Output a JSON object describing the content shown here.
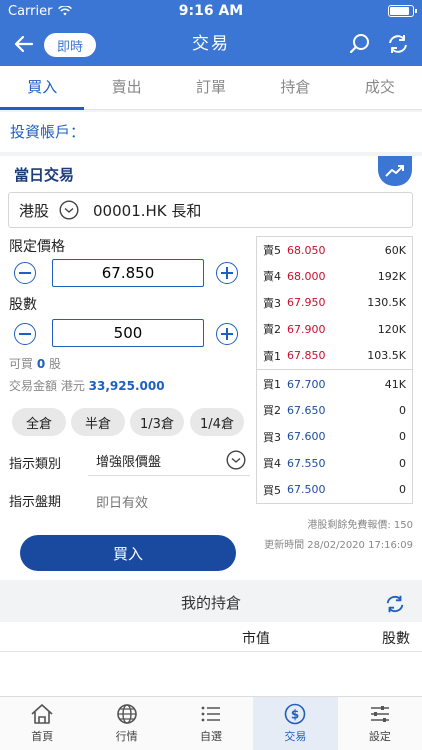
{
  "status": {
    "carrier": "Carrier",
    "time": "9:16 AM"
  },
  "header": {
    "mode_pill": "即時",
    "title": "交易"
  },
  "tabs": [
    {
      "label": "買入",
      "active": true
    },
    {
      "label": "賣出",
      "active": false
    },
    {
      "label": "訂單",
      "active": false
    },
    {
      "label": "持倉",
      "active": false
    },
    {
      "label": "成交",
      "active": false
    }
  ],
  "account": {
    "label": "投資帳戶："
  },
  "trade": {
    "section_title": "當日交易",
    "market": "港股",
    "stock": "00001.HK 長和",
    "limit_price_label": "限定價格",
    "limit_price": "67.850",
    "quantity_label": "股數",
    "quantity": "500",
    "buyable_label": "可買",
    "buyable_value": "0",
    "buyable_unit": "股",
    "amount_label": "交易金額 港元",
    "amount_value": "33,925.000",
    "position_buttons": [
      "全倉",
      "半倉",
      "1/3倉",
      "1/4倉"
    ],
    "order_type_label": "指示類別",
    "order_type_value": "增強限價盤",
    "validity_label": "指示盤期",
    "validity_value": "即日有效",
    "buy_button": "買入",
    "quote_quota": "港股剩餘免費報價: 150",
    "update_time": "更新時間 28/02/2020 17:16:09"
  },
  "order_book": {
    "asks": [
      {
        "side": "賣5",
        "price": "68.050",
        "qty": "60K"
      },
      {
        "side": "賣4",
        "price": "68.000",
        "qty": "192K"
      },
      {
        "side": "賣3",
        "price": "67.950",
        "qty": "130.5K"
      },
      {
        "side": "賣2",
        "price": "67.900",
        "qty": "120K"
      },
      {
        "side": "賣1",
        "price": "67.850",
        "qty": "103.5K"
      }
    ],
    "bids": [
      {
        "side": "買1",
        "price": "67.700",
        "qty": "41K"
      },
      {
        "side": "買2",
        "price": "67.650",
        "qty": "0"
      },
      {
        "side": "買3",
        "price": "67.600",
        "qty": "0"
      },
      {
        "side": "買4",
        "price": "67.550",
        "qty": "0"
      },
      {
        "side": "買5",
        "price": "67.500",
        "qty": "0"
      }
    ],
    "ask_color": "#c8102e",
    "bid_color": "#1e4d9a"
  },
  "holdings": {
    "title": "我的持倉",
    "col_value": "市值",
    "col_shares": "股數"
  },
  "bottom_nav": [
    {
      "label": "首頁",
      "icon": "home-icon",
      "active": false
    },
    {
      "label": "行情",
      "icon": "globe-icon",
      "active": false
    },
    {
      "label": "自選",
      "icon": "list-icon",
      "active": false
    },
    {
      "label": "交易",
      "icon": "trade-icon",
      "active": true
    },
    {
      "label": "設定",
      "icon": "settings-icon",
      "active": false
    }
  ]
}
